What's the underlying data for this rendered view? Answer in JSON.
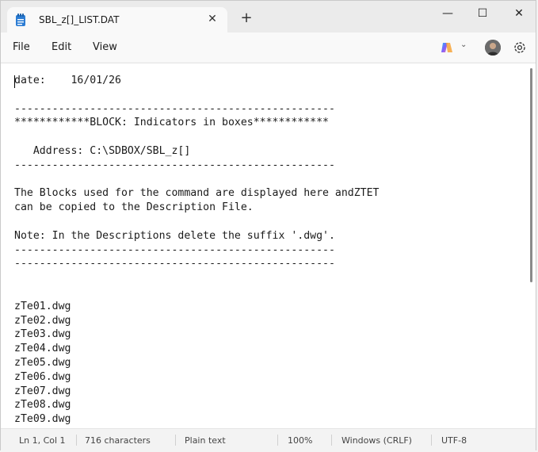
{
  "tab": {
    "title": "SBL_z[]_LIST.DAT",
    "close_glyph": "✕",
    "new_tab_glyph": "+"
  },
  "window_controls": {
    "minimize": "—",
    "maximize": "☐",
    "close": "✕"
  },
  "menu": {
    "file": "File",
    "edit": "Edit",
    "view": "View"
  },
  "editor": {
    "lines": [
      "date:    16/01/26",
      "",
      "---------------------------------------------------",
      "************BLOCK: Indicators in boxes************",
      "",
      "   Address: C:\\SDBOX/SBL_z[]",
      "---------------------------------------------------",
      "",
      "The Blocks used for the command are displayed here andZTET",
      "can be copied to the Description File.",
      "",
      "Note: In the Descriptions delete the suffix '.dwg'.",
      "---------------------------------------------------",
      "---------------------------------------------------",
      "",
      "",
      "zTe01.dwg",
      "zTe02.dwg",
      "zTe03.dwg",
      "zTe04.dwg",
      "zTe05.dwg",
      "zTe06.dwg",
      "zTe07.dwg",
      "zTe08.dwg",
      "zTe09.dwg"
    ]
  },
  "status": {
    "position": "Ln 1, Col 1",
    "characters": "716 characters",
    "format": "Plain text",
    "zoom": "100%",
    "line_ending": "Windows (CRLF)",
    "encoding": "UTF-8"
  },
  "colors": {
    "accent_copilot": "#7b61ff",
    "text": "#1b1b1b"
  }
}
